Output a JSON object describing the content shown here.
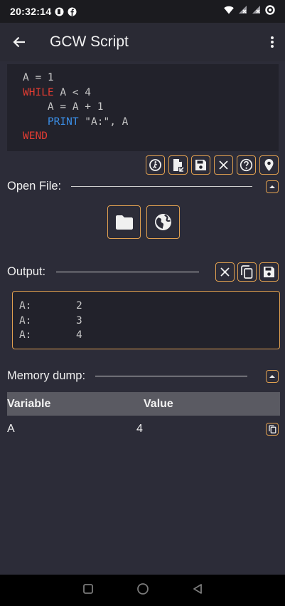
{
  "status_bar": {
    "time": "20:32:14"
  },
  "app_bar": {
    "title": "GCW Script"
  },
  "code": {
    "line1": "A = 1",
    "line2_kw": "WHILE",
    "line2_rest": " A < 4",
    "line3": "A = A + 1",
    "line4_kw": "PRINT",
    "line4_rest": " \"A:\", A",
    "line5_kw": "WEND"
  },
  "open_file": {
    "label": "Open File:"
  },
  "output": {
    "label": "Output:",
    "rows": [
      {
        "k": "A:",
        "v": "2"
      },
      {
        "k": "A:",
        "v": "3"
      },
      {
        "k": "A:",
        "v": "4"
      }
    ]
  },
  "memory_dump": {
    "label": "Memory dump:",
    "col_variable": "Variable",
    "col_value": "Value",
    "rows": [
      {
        "variable": "A",
        "value": "4"
      }
    ]
  },
  "colors": {
    "accent": "#e0a050",
    "keyword_red": "#e03c32",
    "keyword_blue": "#3b8fe8",
    "background": "#2c2c38"
  }
}
